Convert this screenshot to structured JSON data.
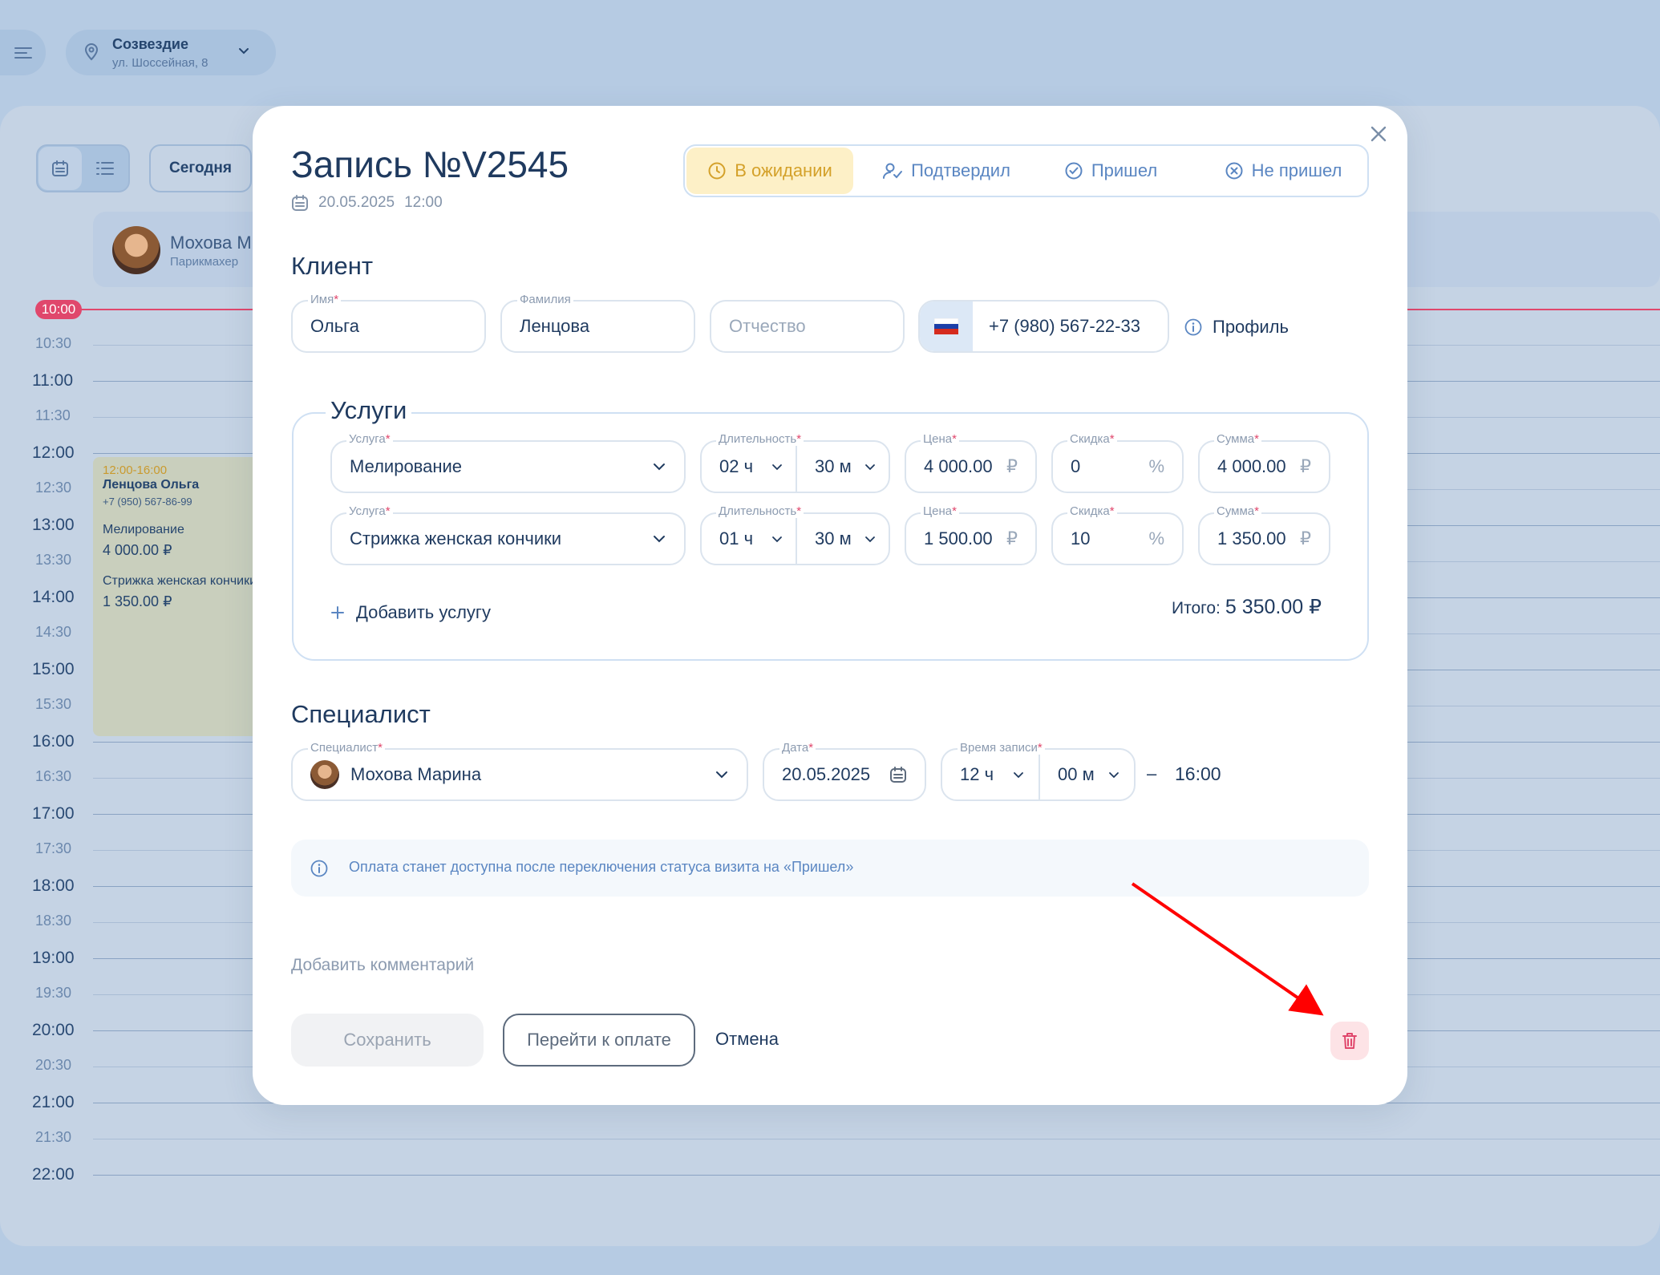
{
  "location": {
    "name": "Созвездие",
    "address": "ул. Шоссейная, 8"
  },
  "calendar": {
    "today_label": "Сегодня",
    "specialist_name": "Мохова М",
    "specialist_role": "Парикмахер",
    "now_label": "10:00",
    "times": [
      {
        "label": "10:30",
        "half": true
      },
      {
        "label": "11:00",
        "half": false
      },
      {
        "label": "11:30",
        "half": true
      },
      {
        "label": "12:00",
        "half": false
      },
      {
        "label": "12:30",
        "half": true
      },
      {
        "label": "13:00",
        "half": false
      },
      {
        "label": "13:30",
        "half": true
      },
      {
        "label": "14:00",
        "half": false
      },
      {
        "label": "14:30",
        "half": true
      },
      {
        "label": "15:00",
        "half": false
      },
      {
        "label": "15:30",
        "half": true
      },
      {
        "label": "16:00",
        "half": false
      },
      {
        "label": "16:30",
        "half": true
      },
      {
        "label": "17:00",
        "half": false
      },
      {
        "label": "17:30",
        "half": true
      },
      {
        "label": "18:00",
        "half": false
      },
      {
        "label": "18:30",
        "half": true
      },
      {
        "label": "19:00",
        "half": false
      },
      {
        "label": "19:30",
        "half": true
      },
      {
        "label": "20:00",
        "half": false
      },
      {
        "label": "20:30",
        "half": true
      },
      {
        "label": "21:00",
        "half": false
      },
      {
        "label": "21:30",
        "half": true
      },
      {
        "label": "22:00",
        "half": false
      }
    ],
    "event": {
      "time": "12:00-16:00",
      "client": "Ленцова Ольга",
      "phone": "+7 (950) 567-86-99",
      "service1": "Мелирование",
      "price1": "4 000.00 ₽",
      "service2": "Стрижка женская кончики",
      "price2": "1 350.00 ₽"
    }
  },
  "modal": {
    "title": "Запись №V2545",
    "date": "20.05.2025",
    "time": "12:00",
    "statuses": [
      {
        "label": "В ожидании",
        "active": true
      },
      {
        "label": "Подтвердил",
        "active": false
      },
      {
        "label": "Пришел",
        "active": false
      },
      {
        "label": "Не пришел",
        "active": false
      }
    ],
    "client": {
      "section_title": "Клиент",
      "first_name_label": "Имя",
      "first_name": "Ольга",
      "last_name_label": "Фамилия",
      "last_name": "Ленцова",
      "patronymic_placeholder": "Отчество",
      "phone": "+7 (980) 567-22-33",
      "profile_label": "Профиль"
    },
    "services": {
      "section_title": "Услуги",
      "labels": {
        "service": "Услуга",
        "duration": "Длительность",
        "price": "Цена",
        "discount": "Скидка",
        "sum": "Сумма"
      },
      "rows": [
        {
          "service": "Мелирование",
          "hours": "02 ч",
          "minutes": "30 м",
          "price": "4 000.00",
          "discount": "0",
          "sum": "4 000.00"
        },
        {
          "service": "Стрижка женская кончики",
          "hours": "01 ч",
          "minutes": "30 м",
          "price": "1 500.00",
          "discount": "10",
          "sum": "1 350.00"
        }
      ],
      "currency": "₽",
      "percent": "%",
      "add_label": "Добавить услугу",
      "total_label": "Итого:",
      "total_value": "5 350.00 ₽"
    },
    "specialist": {
      "section_title": "Специалист",
      "specialist_label": "Специалист",
      "specialist_name": "Мохова Марина",
      "date_label": "Дата",
      "date": "20.05.2025",
      "time_label": "Время записи",
      "hours": "12 ч",
      "minutes": "00 м",
      "dash": "–",
      "end_time": "16:00"
    },
    "info_text": "Оплата станет доступна после переключения статуса визита на «Пришел»",
    "comment_label": "Добавить комментарий",
    "save_label": "Сохранить",
    "pay_label": "Перейти к оплате",
    "cancel_label": "Отмена"
  },
  "colors": {
    "accent": "#5a86c2",
    "required": "#e0476c",
    "pending": "#d4a12a",
    "danger": "#e0476c",
    "annotation_arrow": "#ff0000"
  }
}
